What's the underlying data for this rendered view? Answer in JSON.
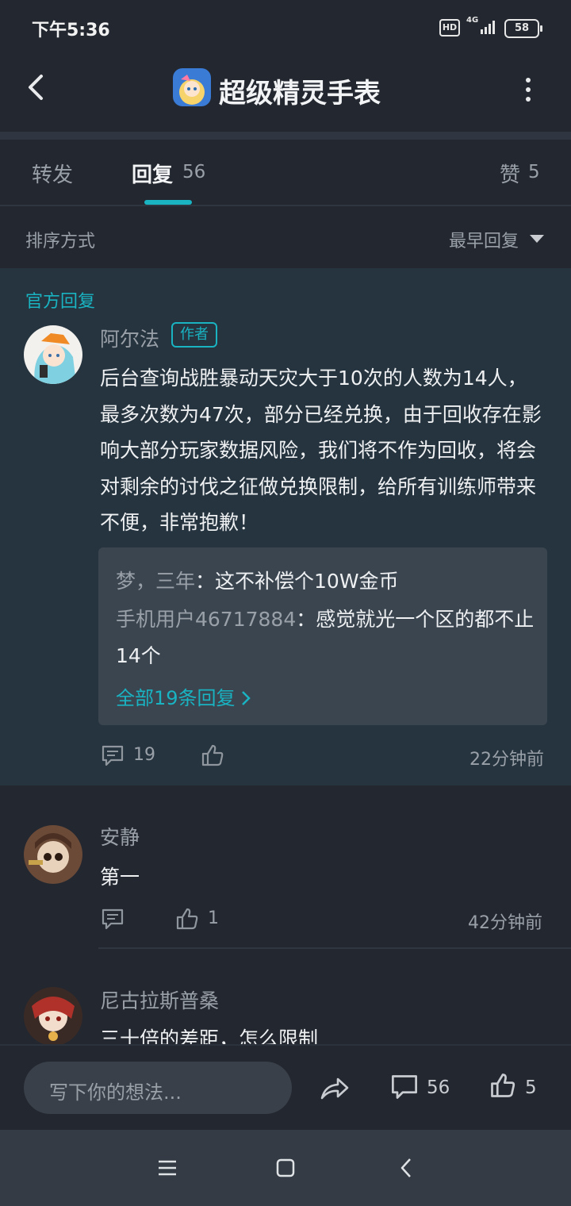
{
  "status_bar": {
    "time": "下午5:36",
    "hd": "HD",
    "network": "4G",
    "battery": "58"
  },
  "header": {
    "title": "超级精灵手表"
  },
  "tabs": {
    "forward": "转发",
    "reply": "回复",
    "reply_count": "56",
    "like": "赞",
    "like_count": "5"
  },
  "sort": {
    "label": "排序方式",
    "value": "最早回复"
  },
  "official_reply": {
    "section_label": "官方回复",
    "author": "阿尔法",
    "badge": "作者",
    "text": "后台查询战胜暴动天灾大于10次的人数为14人，最多次数为47次，部分已经兑换，由于回收存在影响大部分玩家数据风险，我们将不作为回收，将会对剩余的讨伐之征做兑换限制，给所有训练师带来不便，非常抱歉！",
    "sub_replies": [
      {
        "name": "梦，三年",
        "sep": "：",
        "text": "这不补偿个10W金币"
      },
      {
        "name": "手机用户46717884",
        "sep": "：",
        "text": "感觉就光一个区的都不止14个"
      }
    ],
    "all_replies": "全部19条回复",
    "comment_count": "19",
    "time": "22分钟前"
  },
  "comments": [
    {
      "name": "安静",
      "text": "第一",
      "like_count": "1",
      "time": "42分钟前"
    },
    {
      "name": "尼古拉斯普桑",
      "text": "三十倍的差距，怎么限制"
    }
  ],
  "input_bar": {
    "placeholder": "写下你的想法...",
    "comment_count": "56",
    "like_count": "5"
  },
  "colors": {
    "accent": "#19b3c2",
    "background": "#23272f",
    "official_bg": "#26343f",
    "subreply_bg": "#3a4550"
  }
}
